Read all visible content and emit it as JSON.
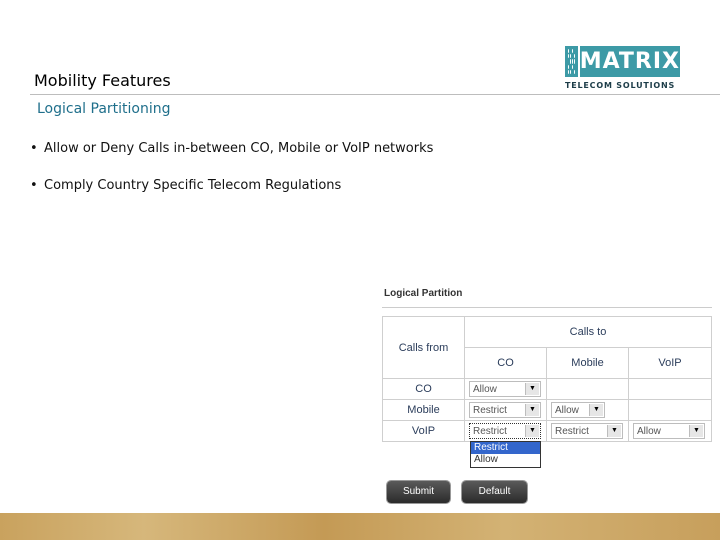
{
  "slide": {
    "title": "Mobility Features",
    "subtitle": "Logical Partitioning",
    "bullets": [
      "Allow or Deny Calls in-between CO, Mobile or VoIP networks",
      "Comply Country Specific Telecom Regulations"
    ],
    "bullet_glyph": "•"
  },
  "logo": {
    "word": "MATRIX",
    "tagline": "TELECOM SOLUTIONS",
    "color": "#3d9aa6"
  },
  "panel": {
    "title": "Logical Partition",
    "header_calls_from": "Calls from",
    "header_calls_to": "Calls to",
    "columns": [
      "CO",
      "Mobile",
      "VoIP"
    ],
    "rows": [
      {
        "label": "CO",
        "values": [
          "Allow",
          "",
          ""
        ]
      },
      {
        "label": "Mobile",
        "values": [
          "Restrict",
          "Allow",
          ""
        ]
      },
      {
        "label": "VoIP",
        "values": [
          "Restrict",
          "Restrict",
          "Allow"
        ]
      }
    ],
    "dropdown_options": [
      "Restrict",
      "Allow"
    ],
    "dropdown_selected": "Restrict",
    "submit_label": "Submit",
    "default_label": "Default"
  }
}
